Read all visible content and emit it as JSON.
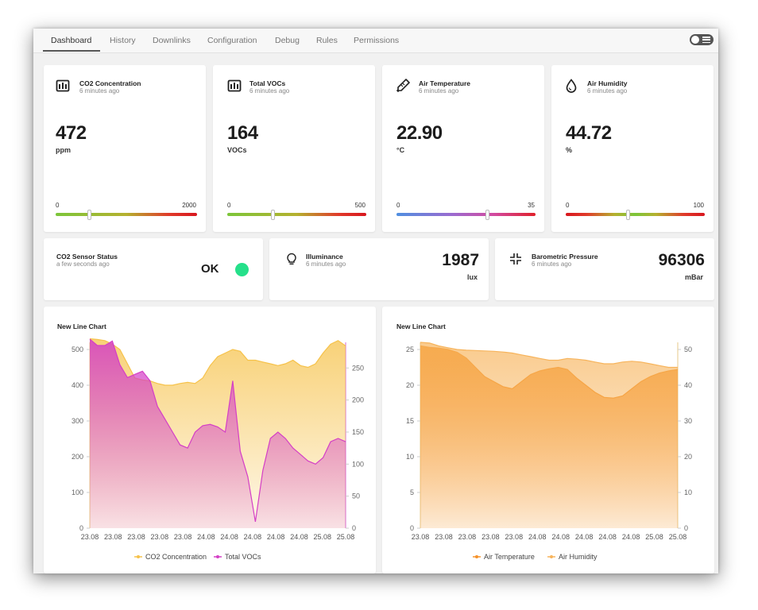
{
  "tabs": [
    {
      "label": "Dashboard"
    },
    {
      "label": "History"
    },
    {
      "label": "Downlinks"
    },
    {
      "label": "Configuration"
    },
    {
      "label": "Debug"
    },
    {
      "label": "Rules"
    },
    {
      "label": "Permissions"
    }
  ],
  "active_tab": "Dashboard",
  "gauges": [
    {
      "title": "CO2 Concentration",
      "subtitle": "6 minutes ago",
      "value": "472",
      "unit": "ppm",
      "min": "0",
      "max": "2000",
      "icon": "co2-sensor-icon",
      "level": 0.236
    },
    {
      "title": "Total VOCs",
      "subtitle": "6 minutes ago",
      "value": "164",
      "unit": "VOCs",
      "min": "0",
      "max": "500",
      "icon": "voc-sensor-icon",
      "level": 0.328
    },
    {
      "title": "Air Temperature",
      "subtitle": "6 minutes ago",
      "value": "22.90",
      "unit": "°C",
      "min": "0",
      "max": "35",
      "icon": "thermometer-icon",
      "level": 0.654
    },
    {
      "title": "Air Humidity",
      "subtitle": "6 minutes ago",
      "value": "44.72",
      "unit": "%",
      "min": "0",
      "max": "100",
      "icon": "water-drop-icon",
      "level": 0.447
    }
  ],
  "status_card": {
    "title": "CO2 Sensor Status",
    "subtitle": "a few seconds ago",
    "value": "OK",
    "status_color": "#25e08a"
  },
  "illuminance": {
    "title": "Illuminance",
    "subtitle": "6 minutes ago",
    "value": "1987",
    "unit": "lux",
    "icon": "lightbulb-icon"
  },
  "pressure": {
    "title": "Barometric Pressure",
    "subtitle": "6 minutes ago",
    "value": "96306",
    "unit": "mBar",
    "icon": "compress-icon"
  },
  "colors": {
    "co2": "#f6c24a",
    "voc": "#d43fc6",
    "temperature": "#f5922a",
    "humidity": "#f7b45c",
    "status_ok": "#25e08a"
  },
  "chart_data": [
    {
      "type": "area",
      "title": "New Line Chart",
      "x_tick_labels": [
        "23.08",
        "23.08",
        "23.08",
        "23.08",
        "23.08",
        "24.08",
        "24.08",
        "24.08",
        "24.08",
        "24.08",
        "25.08",
        "25.08"
      ],
      "y_left": {
        "lim": [
          0,
          520
        ],
        "ticks": [
          0,
          100,
          200,
          300,
          400,
          500
        ]
      },
      "y_right": {
        "lim": [
          0,
          290
        ],
        "ticks": [
          0,
          50,
          100,
          150,
          200,
          250
        ]
      },
      "series": [
        {
          "name": "CO2 Concentration",
          "axis": "left",
          "color": "#f6c24a",
          "values": [
            530,
            528,
            525,
            515,
            500,
            460,
            420,
            415,
            412,
            405,
            400,
            400,
            405,
            408,
            405,
            420,
            455,
            480,
            490,
            500,
            495,
            470,
            470,
            465,
            460,
            455,
            460,
            470,
            455,
            450,
            460,
            490,
            515,
            525,
            510
          ]
        },
        {
          "name": "Total VOCs",
          "axis": "right",
          "color": "#d43fc6",
          "values": [
            295,
            285,
            285,
            292,
            255,
            235,
            240,
            245,
            230,
            190,
            170,
            150,
            130,
            125,
            150,
            160,
            162,
            158,
            150,
            230,
            120,
            80,
            10,
            90,
            140,
            150,
            140,
            125,
            115,
            105,
            100,
            110,
            135,
            140,
            135
          ]
        }
      ],
      "legend_position": "bottom"
    },
    {
      "type": "area",
      "title": "New Line Chart",
      "x_tick_labels": [
        "23.08",
        "23.08",
        "23.08",
        "23.08",
        "23.08",
        "24.08",
        "24.08",
        "24.08",
        "24.08",
        "24.08",
        "25.08",
        "25.08"
      ],
      "y_left": {
        "lim": [
          0,
          26
        ],
        "ticks": [
          0,
          5,
          10,
          15,
          20,
          25
        ]
      },
      "y_right": {
        "lim": [
          0,
          52
        ],
        "ticks": [
          0,
          10,
          20,
          30,
          40,
          50
        ]
      },
      "series": [
        {
          "name": "Air Temperature",
          "axis": "left",
          "color": "#f5922a",
          "values": [
            25.5,
            25.3,
            25.2,
            25.0,
            24.6,
            23.8,
            22.5,
            21.2,
            20.5,
            19.8,
            19.5,
            20.5,
            21.5,
            22.0,
            22.3,
            22.5,
            22.2,
            21.0,
            20.0,
            19.0,
            18.3,
            18.2,
            18.5,
            19.5,
            20.5,
            21.2,
            21.7,
            22.0,
            22.2
          ]
        },
        {
          "name": "Air Humidity",
          "axis": "right",
          "color": "#f7b45c",
          "values": [
            52,
            51.8,
            51,
            50.5,
            50,
            49.8,
            49.7,
            49.6,
            49.5,
            49.3,
            49.0,
            48.5,
            48.0,
            47.5,
            47.0,
            47.0,
            47.5,
            47.3,
            47.0,
            46.5,
            46.0,
            46.0,
            46.5,
            46.7,
            46.5,
            46.0,
            45.5,
            45.0,
            45.0
          ]
        }
      ],
      "legend_position": "bottom"
    }
  ]
}
